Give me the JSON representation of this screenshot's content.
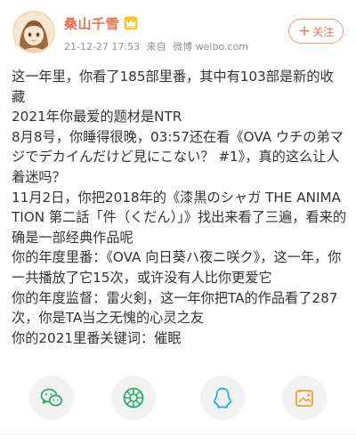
{
  "user": {
    "name": "桑山千雪",
    "badge_icon": "vip-crown-icon",
    "time": "21-12-27 17:53",
    "source_prefix": "来自",
    "source": "微博 weibo.com"
  },
  "follow_button": {
    "label": "关注",
    "icon": "plus-icon"
  },
  "post": {
    "paragraphs": [
      "这一年里，你看了185部里番，其中有103部是新的收藏",
      "2021年你最爱的题材是NTR",
      "8月8号，你睡得很晚，03:57还在看《OVA ウチの弟マジでデカイんだけど見にこない？ #1》，真的这么让人着迷吗？",
      "11月2日，你把2018年的《漆黒のシャガ THE ANIMATION 第二話「件（くだん）」》找出来看了三遍，看来的确是一部经典作品呢",
      "你的年度里番：《OVA 向日葵ハ夜ニ咲ク》，这一年，你一共播放了它15次，或许没有人比你更爱它",
      "你的年度监督：雷火剣，这一年你把TA的作品看了287次，你是TA当之无愧的心灵之友",
      "你的2021里番关键词：催眠"
    ]
  },
  "share": {
    "items": [
      {
        "name": "wechat",
        "icon": "wechat-icon",
        "color": "#2aae67"
      },
      {
        "name": "moments",
        "icon": "moments-icon",
        "color": "#2aae67"
      },
      {
        "name": "qq",
        "icon": "qq-icon",
        "color": "#1aabee"
      },
      {
        "name": "save-image",
        "icon": "save-image-icon",
        "color": "#f0a030"
      }
    ]
  },
  "colors": {
    "accent": "#eb7350",
    "text": "#333333",
    "meta": "#939393",
    "share_bg": "#f2f2f2"
  }
}
